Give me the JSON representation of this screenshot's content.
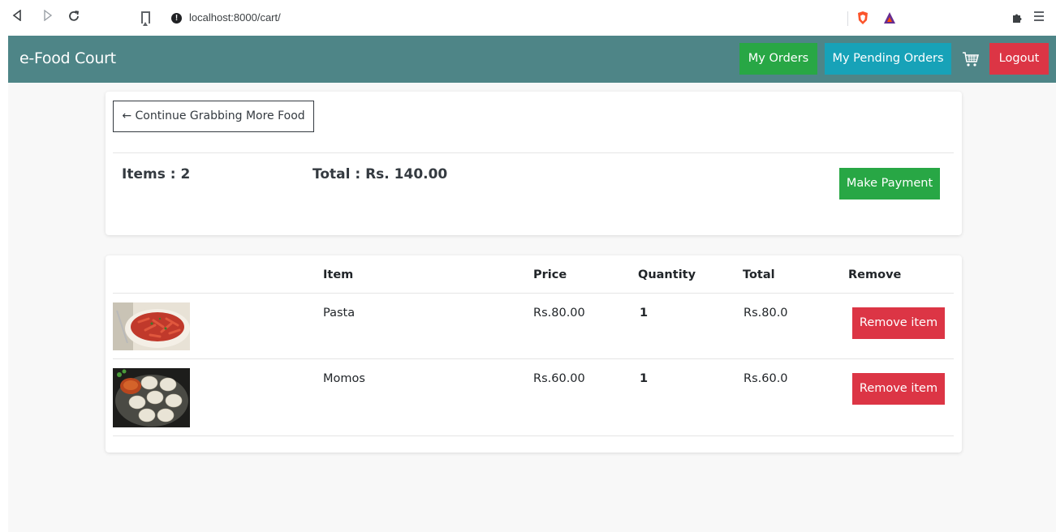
{
  "browser": {
    "url": "localhost:8000/cart/"
  },
  "navbar": {
    "brand": "e-Food Court",
    "my_orders": "My Orders",
    "my_pending_orders": "My Pending Orders",
    "logout": "Logout"
  },
  "summary": {
    "continue_label": "← Continue Grabbing More Food",
    "items_label": "Items : 2",
    "total_label": "Total : Rs. 140.00",
    "payment_label": "Make Payment"
  },
  "table": {
    "headers": [
      "Item",
      "Price",
      "Quantity",
      "Total",
      "Remove"
    ],
    "rows": [
      {
        "name": "Pasta",
        "price": "Rs.80.00",
        "quantity": "1",
        "total": "Rs.80.0",
        "remove": "Remove item"
      },
      {
        "name": "Momos",
        "price": "Rs.60.00",
        "quantity": "1",
        "total": "Rs.60.0",
        "remove": "Remove item"
      }
    ]
  },
  "colors": {
    "navbar": "#4e8587",
    "success": "#28a745",
    "info": "#17a2b8",
    "danger": "#dc3545"
  }
}
